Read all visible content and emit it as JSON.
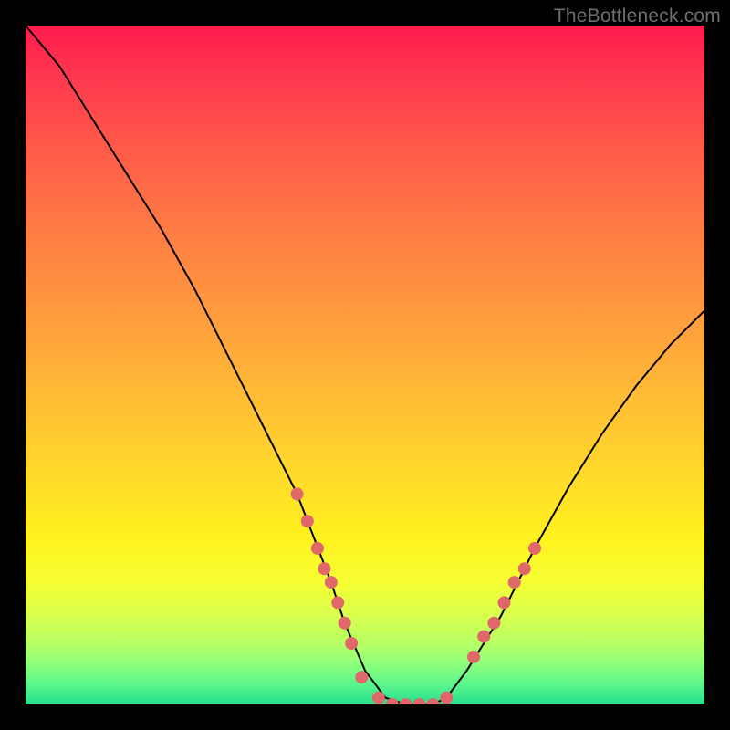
{
  "watermark": {
    "text": "TheBottleneck.com"
  },
  "chart_data": {
    "type": "line",
    "title": "",
    "xlabel": "",
    "ylabel": "",
    "xlim": [
      0,
      100
    ],
    "ylim": [
      0,
      100
    ],
    "grid": false,
    "legend": false,
    "series": [
      {
        "name": "bottleneck-curve",
        "x": [
          0,
          5,
          10,
          15,
          20,
          25,
          30,
          35,
          40,
          45,
          47,
          50,
          53,
          56,
          60,
          62,
          65,
          70,
          75,
          80,
          85,
          90,
          95,
          100
        ],
        "y": [
          100,
          94,
          86,
          78,
          70,
          61,
          51,
          41,
          31,
          18,
          12,
          5,
          1,
          0,
          0,
          1,
          5,
          13,
          23,
          32,
          40,
          47,
          53,
          58
        ]
      }
    ],
    "highlight_segments": [
      {
        "name": "left-dots",
        "x": [
          40,
          41.5,
          43,
          44,
          45,
          46,
          47,
          48,
          49.5
        ],
        "y": [
          31,
          27,
          23,
          20,
          18,
          15,
          12,
          9,
          4
        ]
      },
      {
        "name": "trough-dots",
        "x": [
          52,
          54,
          56,
          58,
          60,
          62
        ],
        "y": [
          1,
          0,
          0,
          0,
          0,
          1
        ]
      },
      {
        "name": "right-dots",
        "x": [
          66,
          67.5,
          69,
          70.5,
          72,
          73.5,
          75
        ],
        "y": [
          7,
          10,
          12,
          15,
          18,
          20,
          23
        ]
      }
    ],
    "colors": {
      "curve": "#000000",
      "dots": "#e0686a",
      "gradient_top": "#ff1a4d",
      "gradient_bottom": "#25e08f",
      "frame": "#000000"
    }
  }
}
